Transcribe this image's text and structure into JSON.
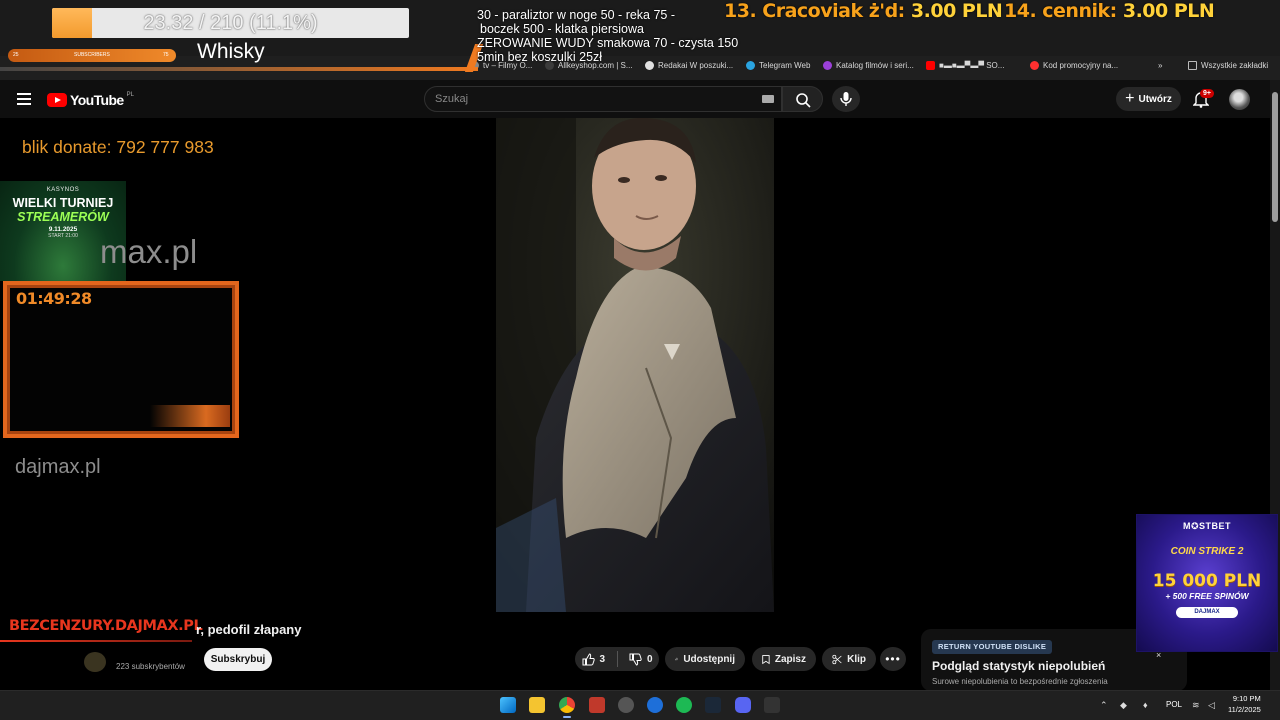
{
  "stream_overlay": {
    "goal_text": "23.32 / 210 (11.1%)",
    "goal_fraction": 0.111,
    "subs_bar_left": "25",
    "subs_bar_label": "SUBSCRIBERS",
    "subs_bar_right": "75",
    "drink": "Whisky",
    "menu_lines": [
      "30 - paraliztor w noge 50 - reka 75 -",
      "boczek 500 - klatka piersiowa",
      "ZEROWANIE WUDY smakowa 70 - czysta 150",
      "5min bez koszulki 25zł"
    ],
    "price_a_label": "13. Cracoviak ż'd:",
    "price_a_value": "3.00 PLN",
    "price_b_label": "14. cennik:",
    "price_b_value": "3.00 PLN",
    "blik": "blik donate: 792 777 983",
    "kasyno": {
      "brand": "KASYNOS",
      "line1": "WIELKI TURNIEJ",
      "line2": "STREAMERÓW",
      "date": "9.11.2025",
      "start": "START 21:00"
    },
    "dajmax_big": "max.pl",
    "timer": "01:49:28",
    "dajmax_small": "dajmax.pl",
    "bezcenzury": "BEZCENZURY.DAJMAX.PL"
  },
  "bookmarks": [
    {
      "label": "tv – Filmy O...",
      "color": "#888888"
    },
    {
      "label": "Allkeyshop.com | S...",
      "color": "#3b3b3b"
    },
    {
      "label": "Redakai W poszuki...",
      "color": "#e0e0e0"
    },
    {
      "label": "Telegram Web",
      "color": "#2aa3e0"
    },
    {
      "label": "Katalog filmów i seri...",
      "color": "#9b40d9"
    },
    {
      "label": "■▬■▬▀▬▀ SO...",
      "color": "#ff0000"
    },
    {
      "label": "Kod promocyjny na...",
      "color": "#ff3030"
    }
  ],
  "all_bookmarks": "Wszystkie zakładki",
  "youtube": {
    "logo": "YouTube",
    "country": "PL",
    "search_placeholder": "Szukaj",
    "create_label": "Utwórz",
    "notif_badge": "9+",
    "video_title": "r, pedofil złapany",
    "subscribers": "223 subskrybentów",
    "subscribe_label": "Subskrybuj",
    "likes": "3",
    "dislikes": "0",
    "share_label": "Udostępnij",
    "save_label": "Zapisz",
    "clip_label": "Klip",
    "more_label": "•••"
  },
  "ryd": {
    "tag": "RETURN YOUTUBE DISLIKE",
    "title": "Podgląd statystyk niepolubień",
    "subtitle": "Surowe niepolubienia to bezpośrednie zgłoszenia",
    "close": "×"
  },
  "mostbet": {
    "brand": "M✪STBET",
    "game": "COIN STRIKE 2",
    "prize": "15 000 PLN",
    "spins": "+ 500 FREE SPINÓW",
    "code": "DAJMAX"
  },
  "taskbar": {
    "lang": "POL",
    "time": "9:10 PM",
    "date": "11/2/2025"
  },
  "colors": {
    "accent_orange": "#f07a20",
    "yt_red": "#ff0000",
    "bez_red": "#e8361e"
  }
}
